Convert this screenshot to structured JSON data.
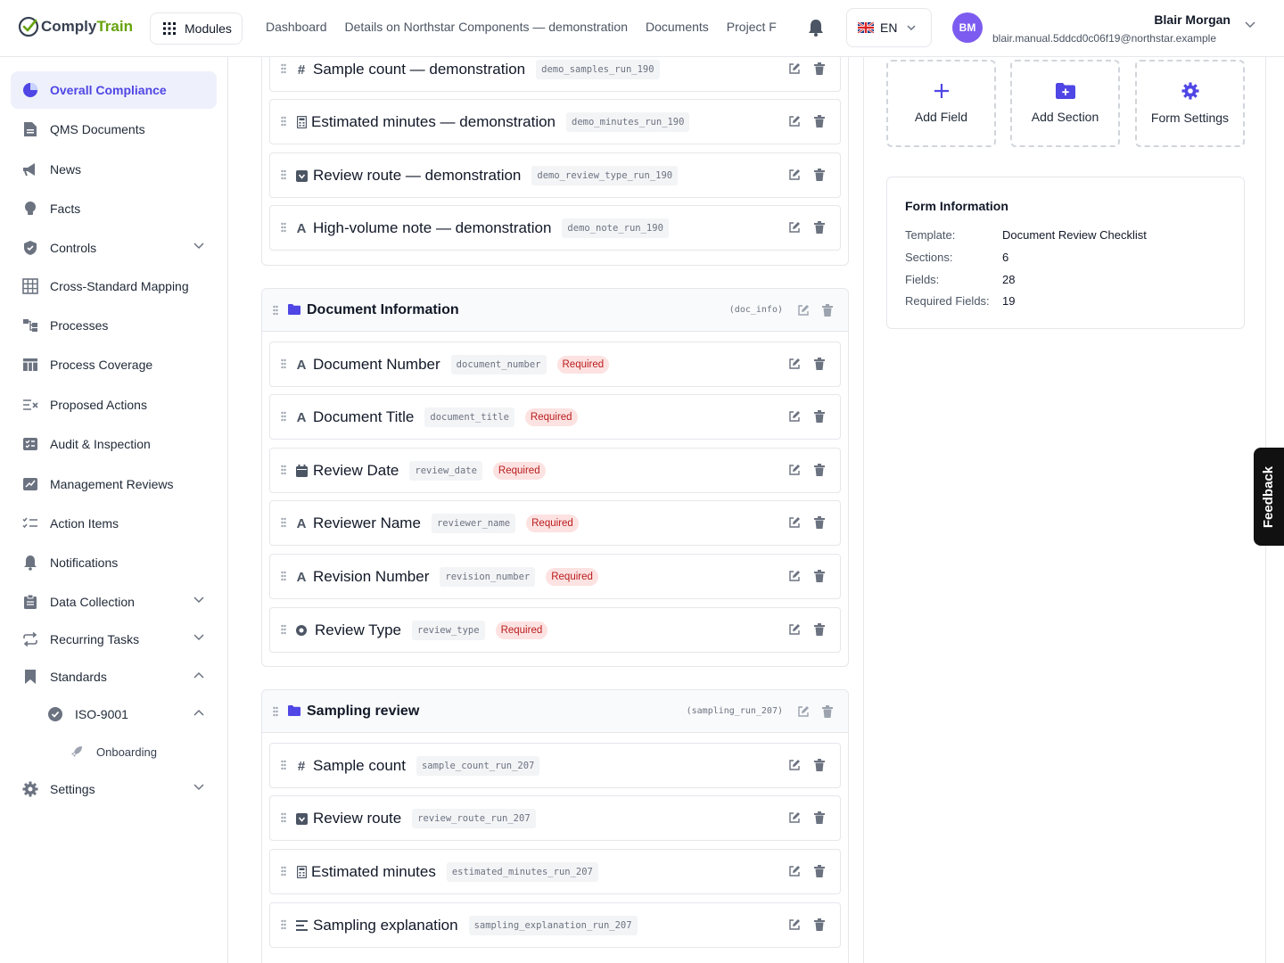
{
  "app": {
    "logo_part1": "Comply",
    "logo_part2": "Train",
    "modules_label": "Modules",
    "nav": [
      "Dashboard",
      "Details on Northstar Components — demonstration",
      "Documents",
      "Project F"
    ],
    "language": "EN",
    "user": {
      "initials": "BM",
      "name": "Blair Morgan",
      "email": "blair.manual.5ddcd0c06f19@northstar.example"
    }
  },
  "sidebar": {
    "items": [
      {
        "label": "Overall Compliance",
        "icon": "pie-chart-icon",
        "active": true
      },
      {
        "label": "QMS Documents",
        "icon": "document-icon"
      },
      {
        "label": "News",
        "icon": "megaphone-icon"
      },
      {
        "label": "Facts",
        "icon": "lightbulb-icon"
      },
      {
        "label": "Controls",
        "icon": "shield-icon",
        "chevron": "down"
      },
      {
        "label": "Cross-Standard Mapping",
        "icon": "grid-icon"
      },
      {
        "label": "Processes",
        "icon": "flow-icon"
      },
      {
        "label": "Process Coverage",
        "icon": "table-icon"
      },
      {
        "label": "Proposed Actions",
        "icon": "list-x-icon"
      },
      {
        "label": "Audit & Inspection",
        "icon": "checklist-icon"
      },
      {
        "label": "Management Reviews",
        "icon": "chart-edit-icon"
      },
      {
        "label": "Action Items",
        "icon": "list-check-icon"
      },
      {
        "label": "Notifications",
        "icon": "bell-icon"
      },
      {
        "label": "Data Collection",
        "icon": "clipboard-icon",
        "chevron": "down"
      },
      {
        "label": "Recurring Tasks",
        "icon": "repeat-icon",
        "chevron": "down"
      },
      {
        "label": "Standards",
        "icon": "bookmark-icon",
        "chevron": "up"
      },
      {
        "label": "ISO-9001",
        "icon": "badge-check-icon",
        "chevron": "up"
      },
      {
        "label": "Onboarding",
        "icon": "rocket-icon"
      },
      {
        "label": "Settings",
        "icon": "gear-icon",
        "chevron": "down"
      }
    ]
  },
  "sections": [
    {
      "title": "",
      "key": "",
      "fields": [
        {
          "type": "#",
          "label": "Sample count — demonstration",
          "key": "demo_samples_run_190",
          "required": ""
        },
        {
          "type": "calc",
          "label": "Estimated minutes — demonstration",
          "key": "demo_minutes_run_190",
          "required": ""
        },
        {
          "type": "select",
          "label": "Review route — demonstration",
          "key": "demo_review_type_run_190",
          "required": ""
        },
        {
          "type": "A",
          "label": "High-volume note — demonstration",
          "key": "demo_note_run_190",
          "required": ""
        }
      ]
    },
    {
      "title": "Document Information",
      "key": "(doc_info)",
      "fields": [
        {
          "type": "A",
          "label": "Document Number",
          "key": "document_number",
          "required": "Required"
        },
        {
          "type": "A",
          "label": "Document Title",
          "key": "document_title",
          "required": "Required"
        },
        {
          "type": "date",
          "label": "Review Date",
          "key": "review_date",
          "required": "Required"
        },
        {
          "type": "A",
          "label": "Reviewer Name",
          "key": "reviewer_name",
          "required": "Required"
        },
        {
          "type": "A",
          "label": "Revision Number",
          "key": "revision_number",
          "required": "Required"
        },
        {
          "type": "radio",
          "label": "Review Type",
          "key": "review_type",
          "required": "Required"
        }
      ]
    },
    {
      "title": "Sampling review",
      "key": "(sampling_run_207)",
      "fields": [
        {
          "type": "#",
          "label": "Sample count",
          "key": "sample_count_run_207",
          "required": ""
        },
        {
          "type": "select",
          "label": "Review route",
          "key": "review_route_run_207",
          "required": ""
        },
        {
          "type": "calc",
          "label": "Estimated minutes",
          "key": "estimated_minutes_run_207",
          "required": ""
        },
        {
          "type": "text",
          "label": "Sampling explanation",
          "key": "sampling_explanation_run_207",
          "required": ""
        }
      ]
    }
  ],
  "actions": {
    "add_field": "Add Field",
    "add_section": "Add Section",
    "form_settings": "Form Settings"
  },
  "form_info": {
    "title": "Form Information",
    "template_label": "Template:",
    "template_value": "Document Review Checklist",
    "sections_label": "Sections:",
    "sections_value": "6",
    "fields_label": "Fields:",
    "fields_value": "28",
    "required_label": "Required Fields:",
    "required_value": "19"
  },
  "feedback_label": "Feedback",
  "colors": {
    "accent": "#4f46e5",
    "brand_green": "#65a30d",
    "required_text": "#b91c1c",
    "required_bg": "#fde2e2"
  }
}
